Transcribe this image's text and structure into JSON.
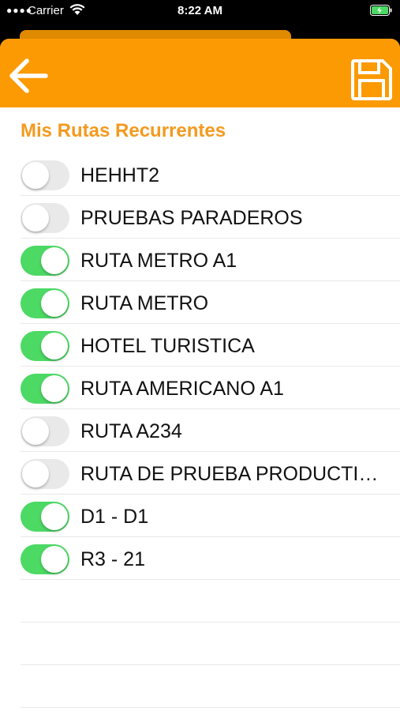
{
  "status_bar": {
    "carrier": "Carrier",
    "time": "8:22 AM",
    "battery_color": "#4cd964"
  },
  "nav": {
    "back_icon": "arrow-left-icon",
    "save_icon": "floppy-disk-icon",
    "background": "#fb9a03"
  },
  "section": {
    "title": "Mis Rutas Recurrentes",
    "title_color": "#f39a1f"
  },
  "routes": [
    {
      "label": "HEHHT2",
      "enabled": false
    },
    {
      "label": "PRUEBAS PARADEROS",
      "enabled": false
    },
    {
      "label": "RUTA METRO A1",
      "enabled": true
    },
    {
      "label": "RUTA METRO",
      "enabled": true
    },
    {
      "label": "HOTEL TURISTICA",
      "enabled": true
    },
    {
      "label": "RUTA AMERICANO A1",
      "enabled": true
    },
    {
      "label": "RUTA A234",
      "enabled": false
    },
    {
      "label": "RUTA DE PRUEBA PRODUCTI…",
      "enabled": false
    },
    {
      "label": "D1 - D1",
      "enabled": true
    },
    {
      "label": "R3 - 21",
      "enabled": true
    }
  ],
  "toggle_colors": {
    "on": "#4cd964",
    "off": "#e9e9ea"
  }
}
